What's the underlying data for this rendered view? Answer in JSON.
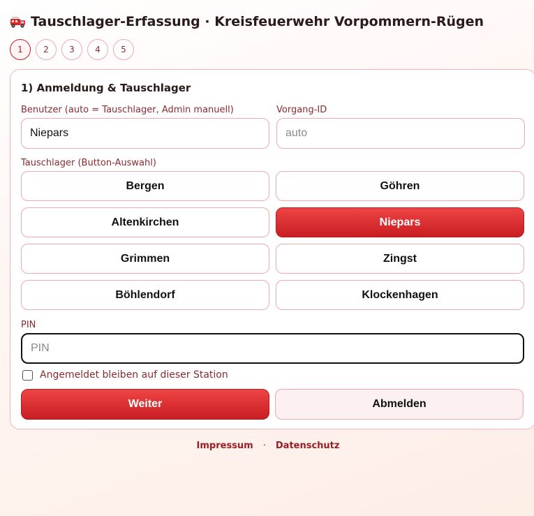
{
  "header": {
    "icon": "fire-truck-icon",
    "title": "Tauschlager-Erfassung · Kreisfeuerwehr Vorpommern-Rügen"
  },
  "steps": [
    {
      "label": "1",
      "active": true
    },
    {
      "label": "2",
      "active": false
    },
    {
      "label": "3",
      "active": false
    },
    {
      "label": "4",
      "active": false
    },
    {
      "label": "5",
      "active": false
    }
  ],
  "form": {
    "section_title": "1) Anmeldung & Tauschlager",
    "user": {
      "label": "Benutzer (auto = Tauschlager, Admin manuell)",
      "value": "Niepars"
    },
    "process": {
      "label": "Vorgang-ID",
      "placeholder": "auto"
    },
    "warehouse": {
      "label": "Tauschlager (Button-Auswahl)",
      "selected": "Niepars",
      "options": [
        "Bergen",
        "Göhren",
        "Altenkirchen",
        "Niepars",
        "Grimmen",
        "Zingst",
        "Böhlendorf",
        "Klockenhagen"
      ]
    },
    "pin": {
      "label": "PIN",
      "placeholder": "PIN"
    },
    "remember": {
      "label": "Angemeldet bleiben auf dieser Station",
      "checked": false
    },
    "next_label": "Weiter",
    "logout_label": "Abmelden"
  },
  "footer": {
    "imprint": "Impressum",
    "separator": "·",
    "privacy": "Datenschutz"
  },
  "colors": {
    "accent": "#d9262c",
    "border": "#f0a8ae",
    "label": "#8a2a30"
  }
}
